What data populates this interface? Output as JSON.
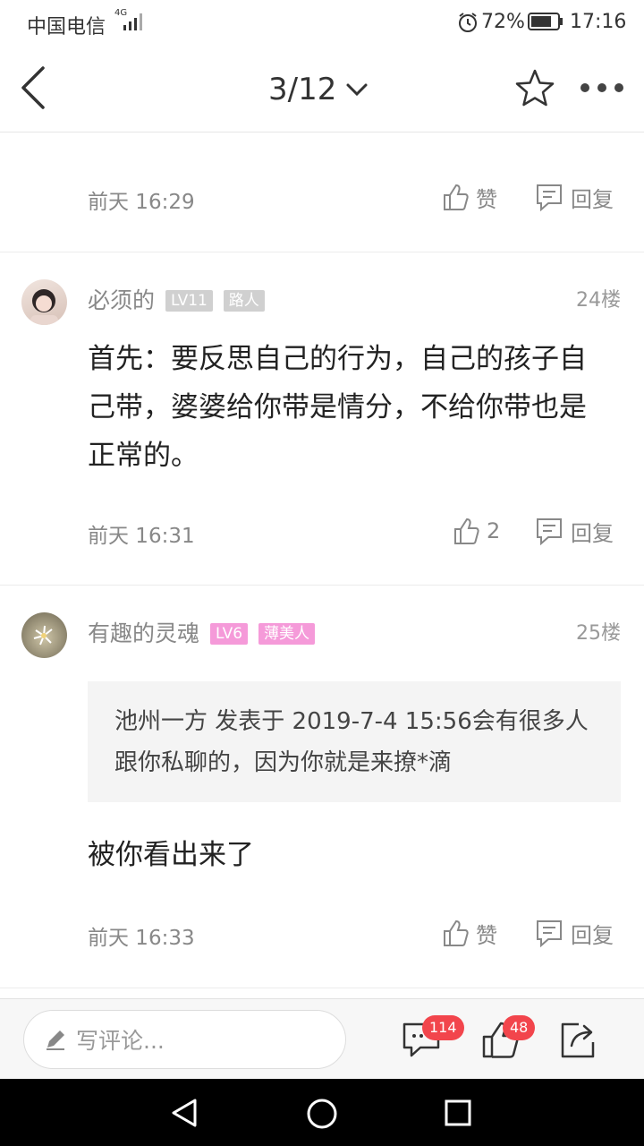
{
  "status": {
    "carrier": "中国电信",
    "network": "4G",
    "battery": "72%",
    "time": "17:16"
  },
  "topbar": {
    "page_indicator": "3/12",
    "icons": [
      "back-arrow-icon",
      "chevron-down-icon",
      "star-icon",
      "more-icon"
    ]
  },
  "posts": [
    {
      "time": "前天 16:29",
      "like_label": "赞",
      "reply_label": "回复"
    },
    {
      "author": "必须的",
      "level": "LV11",
      "title": "路人",
      "floor": "24楼",
      "body": "首先：要反思自己的行为，自己的孩子自己带，婆婆给你带是情分，不给你带也是正常的。",
      "time": "前天 16:31",
      "like_label": "2",
      "reply_label": "回复"
    },
    {
      "author": "有趣的灵魂",
      "level": "LV6",
      "title": "薄美人",
      "floor": "25楼",
      "quote": "池州一方 发表于 2019-7-4 15:56会有很多人跟你私聊的，因为你就是来撩*滴",
      "body": "被你看出来了",
      "time": "前天 16:33",
      "like_label": "赞",
      "reply_label": "回复"
    }
  ],
  "bottombar": {
    "comment_placeholder": "写评论...",
    "comments_count": "114",
    "likes_count": "48"
  },
  "colors": {
    "badge_gray": "#d0d0d0",
    "badge_pink": "#f59ad9",
    "count_badge": "#f2454c"
  }
}
